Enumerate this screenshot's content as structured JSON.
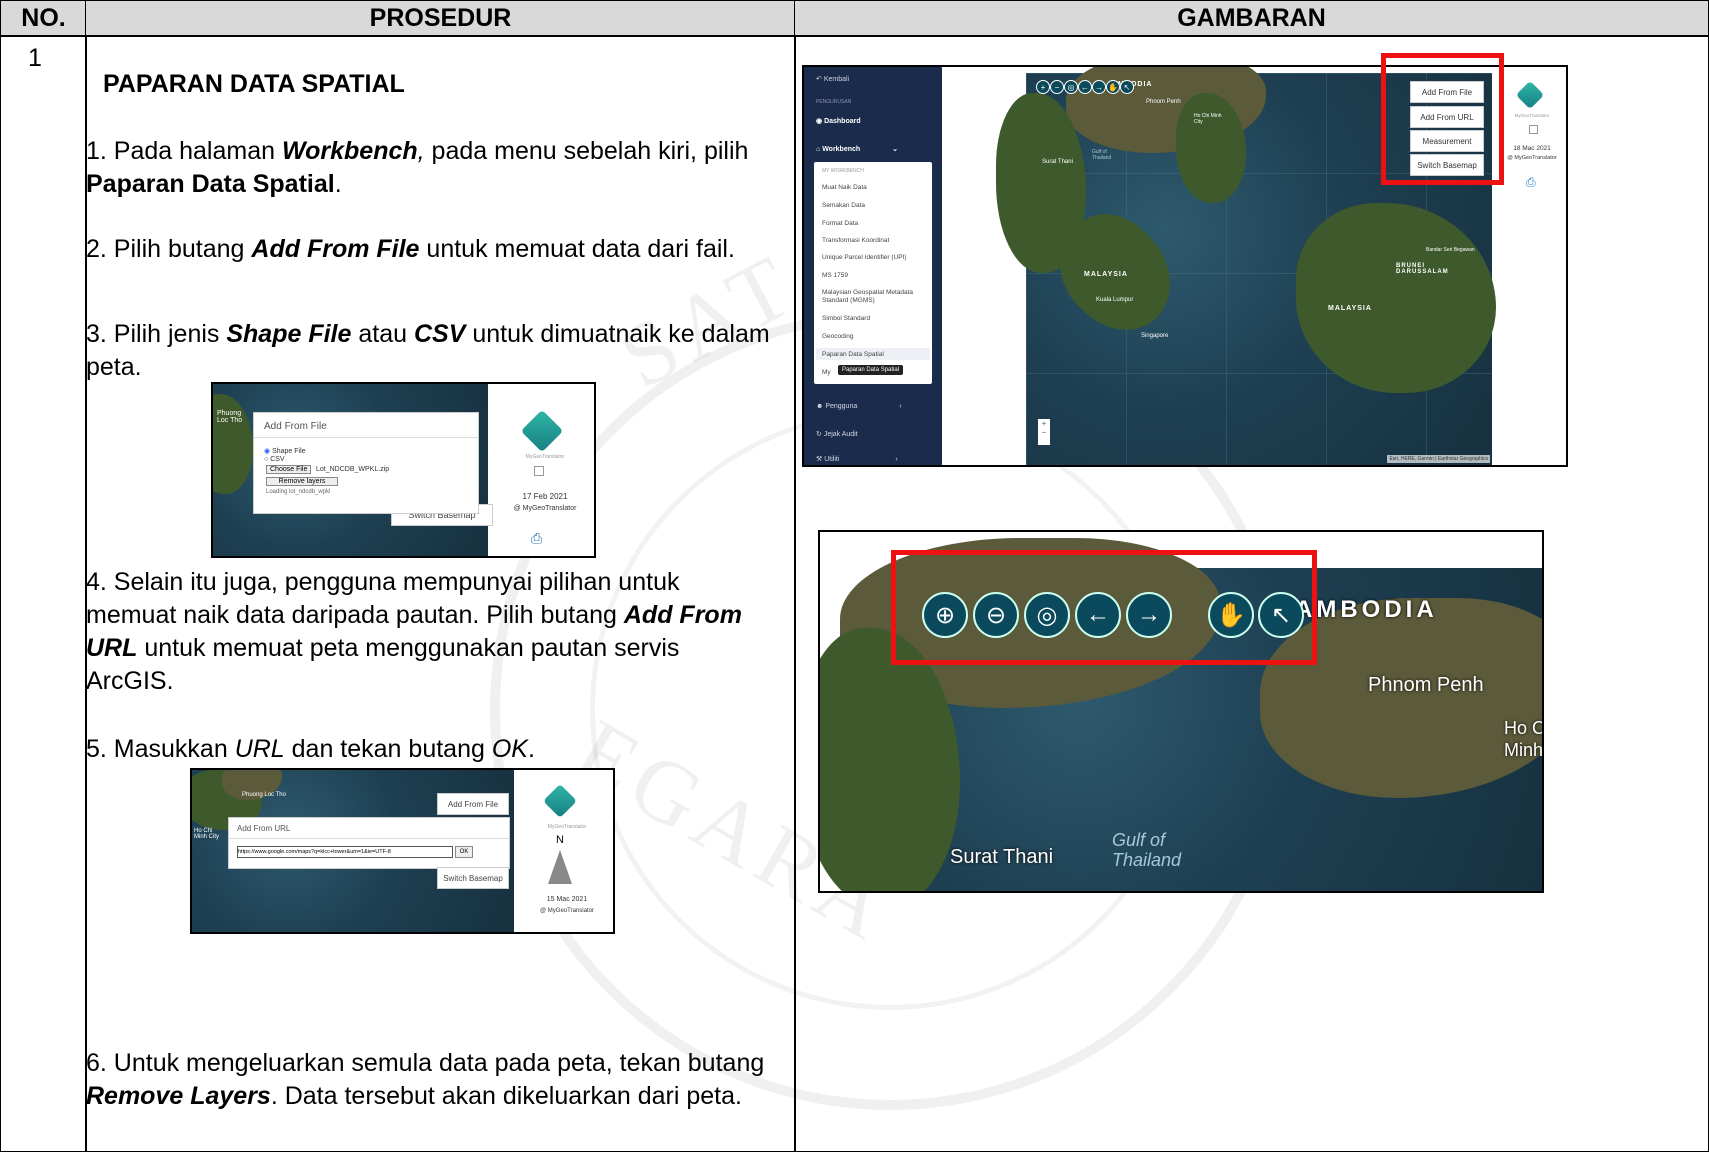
{
  "table": {
    "headers": {
      "no": "NO.",
      "prosedur": "PROSEDUR",
      "gambaran": "GAMBARAN"
    },
    "row_number": "1"
  },
  "watermark": {
    "text1": "SAT GEOS",
    "text2": "PATIAL",
    "text3": "EGARA"
  },
  "procedure": {
    "title": "PAPARAN DATA SPATIAL",
    "step1": {
      "a": "1. Pada halaman ",
      "b": "Workbench",
      "c": ",",
      "d": " pada menu sebelah kiri, pilih ",
      "e": "Paparan Data Spatial",
      "f": "."
    },
    "step2": {
      "a": "2. Pilih butang ",
      "b": "Add From File",
      "c": " untuk memuat data dari fail."
    },
    "step3": {
      "a": "3. Pilih jenis ",
      "b": "Shape File",
      "c": " atau ",
      "d": "CSV",
      "e": " untuk dimuatnaik ke dalam peta."
    },
    "step4": {
      "a": "4. Selain itu juga, pengguna mempunyai pilihan untuk memuat naik data daripada pautan. Pilih butang ",
      "b": "Add From URL",
      "c": " untuk memuat peta menggunakan pautan servis ArcGIS."
    },
    "step5": {
      "a": "5. Masukkan ",
      "b": "URL",
      "c": " dan tekan butang ",
      "d": "OK",
      "e": "."
    },
    "step6": {
      "a": "6. Untuk mengeluarkan semula data pada peta, tekan butang ",
      "b": "Remove Layers",
      "c": ". Data tersebut akan dikeluarkan dari peta."
    }
  },
  "shot_file": {
    "map_label": "Phuong Loc Tho",
    "dialog_title": "Add From File",
    "radio_shape": "Shape File",
    "radio_csv": "CSV",
    "choose_btn": "Choose File",
    "file_name": "Lot_NDCDB_WPKL.zip",
    "remove_btn": "Remove layers",
    "loading": "Loading lot_ndcdb_wpkl",
    "switch_basemap": "Switch Basemap",
    "brand": "MyGeoTranslator",
    "date": "17 Feb 2021",
    "credit": "@ MyGeoTranslator"
  },
  "shot_url": {
    "map_label": "Phuong Loc Tho",
    "map_label2": "Ho Chi Minh City",
    "add_file_btn": "Add From File",
    "dialog_title": "Add From URL",
    "url_value": "https://www.google.com/maps?q=klcc+tower&um=1&ie=UTF-8",
    "ok_btn": "OK",
    "switch_basemap": "Switch Basemap",
    "brand": "MyGeoTranslator",
    "north": "N",
    "date": "15 Mac 2021",
    "credit": "@ MyGeoTranslator"
  },
  "shot_main": {
    "sidebar": {
      "back": "Kembali",
      "section": "PENGURUSAN",
      "dashboard": "Dashboard",
      "workbench": "Workbench",
      "menu_title": "MY WORKBENCH",
      "items": [
        "Muat Naik Data",
        "Semakan Data",
        "Format Data",
        "Transformasi Koordinat",
        "Unique Parcel Identifier (UPI)",
        "MS 1759",
        "Malaysian Geospatial Metadata Standard (MGMS)",
        "Simbol Standard",
        "Geocoding",
        "Paparan Data Spatial"
      ],
      "tooltip": "Paparan Data Spatial",
      "item_partial": "My",
      "pengguna": "Pengguna",
      "jejak": "Jejak Audit",
      "utiliti": "Utiliti"
    },
    "buttons": [
      "Add From File",
      "Add From URL",
      "Measurement",
      "Switch Basemap"
    ],
    "labels": {
      "cambodia": "AMBODIA",
      "malaysia1": "MALAYSIA",
      "malaysia2": "MALAYSIA",
      "brunei": "BRUNEI DARUSSALAM",
      "singapore": "Singapore",
      "kl": "Kuala Lumpur",
      "phnom": "Phnom Penh",
      "hcm": "Ho Chi Minh City",
      "surat": "Surat Thani",
      "gulf": "Gulf of Thailand",
      "bandar": "Bandar Seri Begawan"
    },
    "date": "18 Mac 2021",
    "credit": "@ MyGeoTranslator",
    "brand": "MyGeoTranslator",
    "attribution": "Esri, HERE, Garmin | Earthstar Geographics"
  },
  "shot_zoom": {
    "label_cambodia": "AMBODIA",
    "label_phnom": "Phnom Penh",
    "label_ho": "Ho C",
    "label_minh": "Minh",
    "label_surat": "Surat Thani",
    "label_gulf": "Gulf of Thailand",
    "tools": [
      "zoom-in",
      "zoom-out",
      "globe",
      "back",
      "forward",
      "pan",
      "select"
    ]
  }
}
